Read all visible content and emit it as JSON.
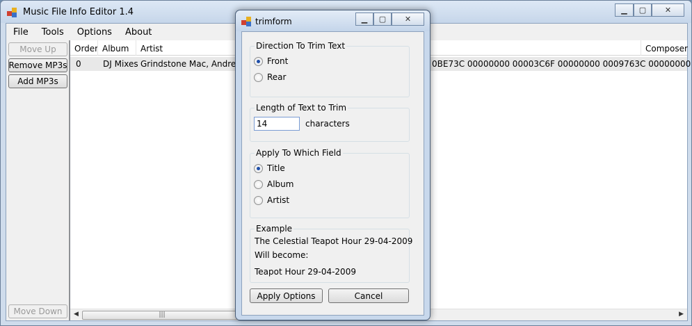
{
  "main": {
    "title": "Music File Info Editor 1.4",
    "menu": [
      "File",
      "Tools",
      "Options",
      "About"
    ],
    "buttons": {
      "move_up": "Move Up",
      "remove": "Remove MP3s",
      "add": "Add MP3s",
      "move_down": "Move Down"
    },
    "columns": [
      "Order",
      "Album",
      "Artist",
      "Composer"
    ],
    "rows": [
      {
        "order": "0",
        "album": "DJ Mixes",
        "artist": "Grindstone Mac, Andrei 'The",
        "tail": "0BE73C 00000000 00003C6F 00000000 0009763C 00000000"
      }
    ]
  },
  "dialog": {
    "title": "trimform",
    "direction": {
      "label": "Direction To Trim Text",
      "options": [
        "Front",
        "Rear"
      ],
      "selected": "Front"
    },
    "length": {
      "label": "Length of Text to Trim",
      "value": "14",
      "unit": "characters"
    },
    "field": {
      "label": "Apply To Which Field",
      "options": [
        "Title",
        "Album",
        "Artist"
      ],
      "selected": "Title"
    },
    "example": {
      "label": "Example",
      "before": "The Celestial Teapot Hour 29-04-2009",
      "middle": "Will become:",
      "after": "Teapot Hour 29-04-2009"
    },
    "buttons": {
      "apply": "Apply Options",
      "cancel": "Cancel"
    }
  }
}
